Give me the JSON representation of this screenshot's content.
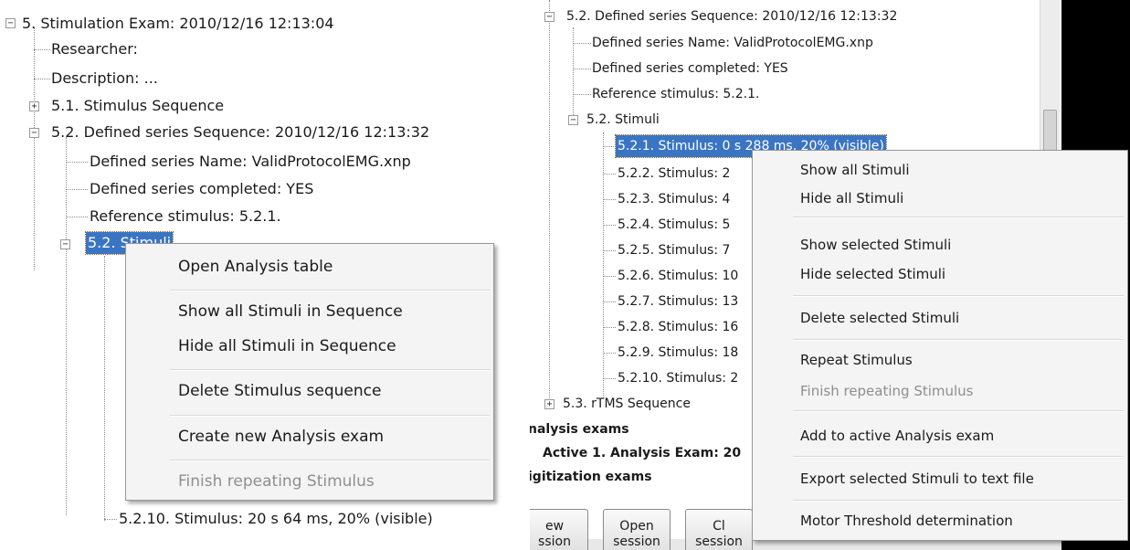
{
  "left": {
    "tree": [
      {
        "text": "5. Stimulation Exam: 2010/12/16 12:13:04",
        "expander": "−"
      },
      {
        "text": "Researcher:"
      },
      {
        "text": "Description: ..."
      },
      {
        "text": "5.1. Stimulus Sequence",
        "expander": "+"
      },
      {
        "text": "5.2. Defined series Sequence: 2010/12/16 12:13:32",
        "expander": "−"
      },
      {
        "text": "Defined series Name: ValidProtocolEMG.xnp"
      },
      {
        "text": "Defined series completed: YES"
      },
      {
        "text": "Reference stimulus: 5.2.1."
      },
      {
        "text": "5.2. Stimuli",
        "expander": "−"
      },
      {
        "text": "5.2.10. Stimulus: 20 s 64 ms, 20% (visible)"
      }
    ],
    "menu": [
      {
        "label": "Open Analysis table"
      },
      {
        "label": "Show all Stimuli in Sequence"
      },
      {
        "label": "Hide all Stimuli in Sequence"
      },
      {
        "label": "Delete Stimulus sequence"
      },
      {
        "label": "Create new Analysis exam"
      },
      {
        "label": "Finish repeating Stimulus",
        "disabled": true
      }
    ]
  },
  "right": {
    "tree": [
      {
        "text": "5.2. Defined series Sequence: 2010/12/16 12:13:32",
        "expander": "−"
      },
      {
        "text": "Defined series Name: ValidProtocolEMG.xnp"
      },
      {
        "text": "Defined series completed: YES"
      },
      {
        "text": "Reference stimulus: 5.2.1."
      },
      {
        "text": "5.2. Stimuli",
        "expander": "−"
      },
      {
        "text": "5.2.1. Stimulus: 0 s 288 ms, 20% (visible)"
      },
      {
        "text": "5.2.2. Stimulus: 2"
      },
      {
        "text": "5.2.3. Stimulus: 4"
      },
      {
        "text": "5.2.4. Stimulus: 5"
      },
      {
        "text": "5.2.5. Stimulus: 7"
      },
      {
        "text": "5.2.6. Stimulus: 10"
      },
      {
        "text": "5.2.7. Stimulus: 13"
      },
      {
        "text": "5.2.8. Stimulus: 16"
      },
      {
        "text": "5.2.9. Stimulus: 18"
      },
      {
        "text": "5.2.10. Stimulus: 2"
      },
      {
        "text": "5.3. rTMS Sequence",
        "expander": "+"
      },
      {
        "text": "nalysis exams"
      },
      {
        "text": "Active 1. Analysis Exam: 20"
      },
      {
        "text": "igitization exams"
      }
    ],
    "menu": [
      {
        "label": "Show all Stimuli"
      },
      {
        "label": "Hide all Stimuli"
      },
      {
        "label": "Show selected Stimuli"
      },
      {
        "label": "Hide selected Stimuli"
      },
      {
        "label": "Delete selected Stimuli"
      },
      {
        "label": "Repeat Stimulus"
      },
      {
        "label": "Finish repeating Stimulus",
        "disabled": true
      },
      {
        "label": "Add to active Analysis exam"
      },
      {
        "label": "Export selected Stimuli to text file"
      },
      {
        "label": "Motor Threshold determination"
      }
    ],
    "buttons": [
      {
        "label": "ew\nssion"
      },
      {
        "label": "Open\nsession"
      },
      {
        "label": "Cl\nsession"
      }
    ]
  }
}
